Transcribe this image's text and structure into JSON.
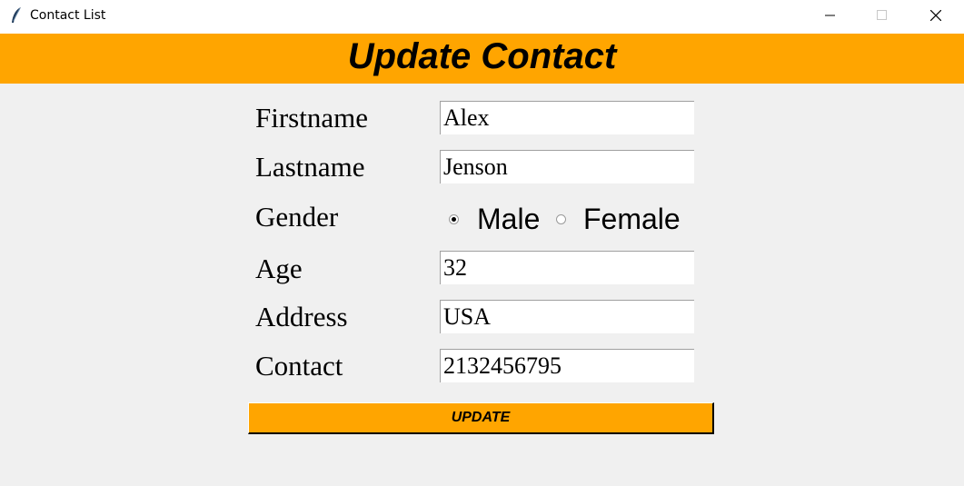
{
  "window": {
    "title": "Contact List"
  },
  "header": {
    "title": "Update Contact",
    "background": "#ffa500"
  },
  "form": {
    "firstname": {
      "label": "Firstname",
      "value": "Alex"
    },
    "lastname": {
      "label": "Lastname",
      "value": "Jenson"
    },
    "gender": {
      "label": "Gender",
      "options": [
        "Male",
        "Female"
      ],
      "selected": "Male"
    },
    "age": {
      "label": "Age",
      "value": "32"
    },
    "address": {
      "label": "Address",
      "value": "USA"
    },
    "contact": {
      "label": "Contact",
      "value": "2132456795"
    }
  },
  "update_button": {
    "label": "UPDATE"
  }
}
